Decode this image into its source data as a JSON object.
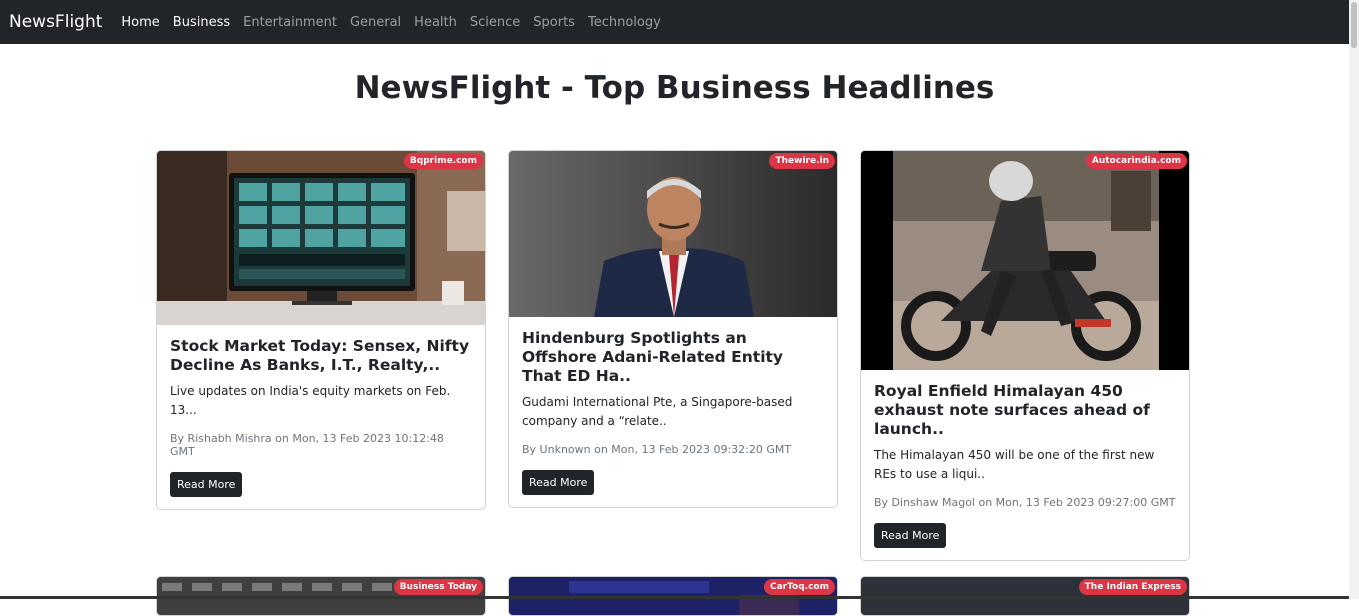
{
  "navbar": {
    "brand": "NewsFlight",
    "links": [
      {
        "label": "Home",
        "active": true
      },
      {
        "label": "Business",
        "active": false
      },
      {
        "label": "Entertainment",
        "active": false
      },
      {
        "label": "General",
        "active": false
      },
      {
        "label": "Health",
        "active": false
      },
      {
        "label": "Science",
        "active": false
      },
      {
        "label": "Sports",
        "active": false
      },
      {
        "label": "Technology",
        "active": false
      }
    ]
  },
  "page": {
    "title": "NewsFlight - Top Business Headlines"
  },
  "cards": [
    {
      "source": "Bqprime.com",
      "title": "Stock Market Today: Sensex, Nifty Decline As Banks, I.T., Realty,..",
      "description": "Live updates on India's equity markets on Feb. 13...",
      "meta": "By Rishabh Mishra on Mon, 13 Feb 2023 10:12:48 GMT",
      "button": "Read More"
    },
    {
      "source": "Thewire.in",
      "title": "Hindenburg Spotlights an Offshore Adani-Related Entity That ED Ha..",
      "description": "Gudami International Pte, a Singapore-based company and a “relate..",
      "meta": "By Unknown on Mon, 13 Feb 2023 09:32:20 GMT",
      "button": "Read More"
    },
    {
      "source": "Autocarindia.com",
      "title": "Royal Enfield Himalayan 450 exhaust note surfaces ahead of launch..",
      "description": "The Himalayan 450 will be one of the first new REs to use a liqui..",
      "meta": "By Dinshaw Magol on Mon, 13 Feb 2023 09:27:00 GMT",
      "button": "Read More"
    }
  ],
  "second_row_badges": [
    "Business Today",
    "CarToq.com",
    "The Indian Express"
  ],
  "colors": {
    "navbar_bg": "#212529",
    "badge_bg": "#dc3545",
    "button_bg": "#212529",
    "text": "#212529",
    "muted": "#6c757d"
  }
}
